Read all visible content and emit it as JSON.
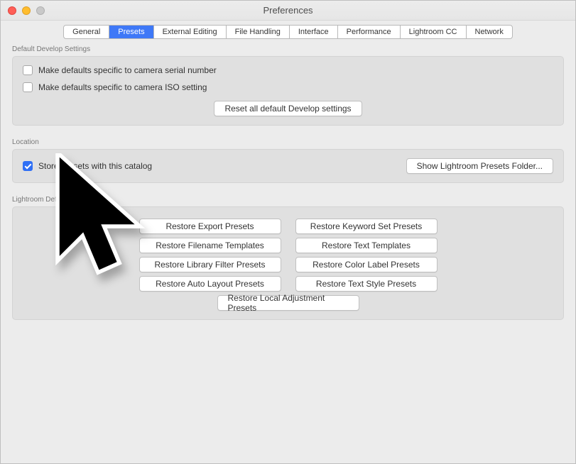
{
  "window": {
    "title": "Preferences"
  },
  "tabs": [
    {
      "label": "General"
    },
    {
      "label": "Presets",
      "selected": true
    },
    {
      "label": "External Editing"
    },
    {
      "label": "File Handling"
    },
    {
      "label": "Interface"
    },
    {
      "label": "Performance"
    },
    {
      "label": "Lightroom CC"
    },
    {
      "label": "Network"
    }
  ],
  "develop": {
    "group_label": "Default Develop Settings",
    "cb_serial": "Make defaults specific to camera serial number",
    "cb_iso": "Make defaults specific to camera ISO setting",
    "reset_btn": "Reset all default Develop settings"
  },
  "location": {
    "group_label": "Location",
    "cb_store": "Store presets with this catalog",
    "show_btn": "Show Lightroom Presets Folder..."
  },
  "defaults": {
    "group_label": "Lightroom Defaults",
    "btns": [
      "Restore Export Presets",
      "Restore Keyword Set Presets",
      "Restore Filename Templates",
      "Restore Text Templates",
      "Restore Library Filter Presets",
      "Restore Color Label Presets",
      "Restore Auto Layout Presets",
      "Restore Text Style Presets"
    ],
    "last_btn": "Restore Local Adjustment Presets"
  }
}
